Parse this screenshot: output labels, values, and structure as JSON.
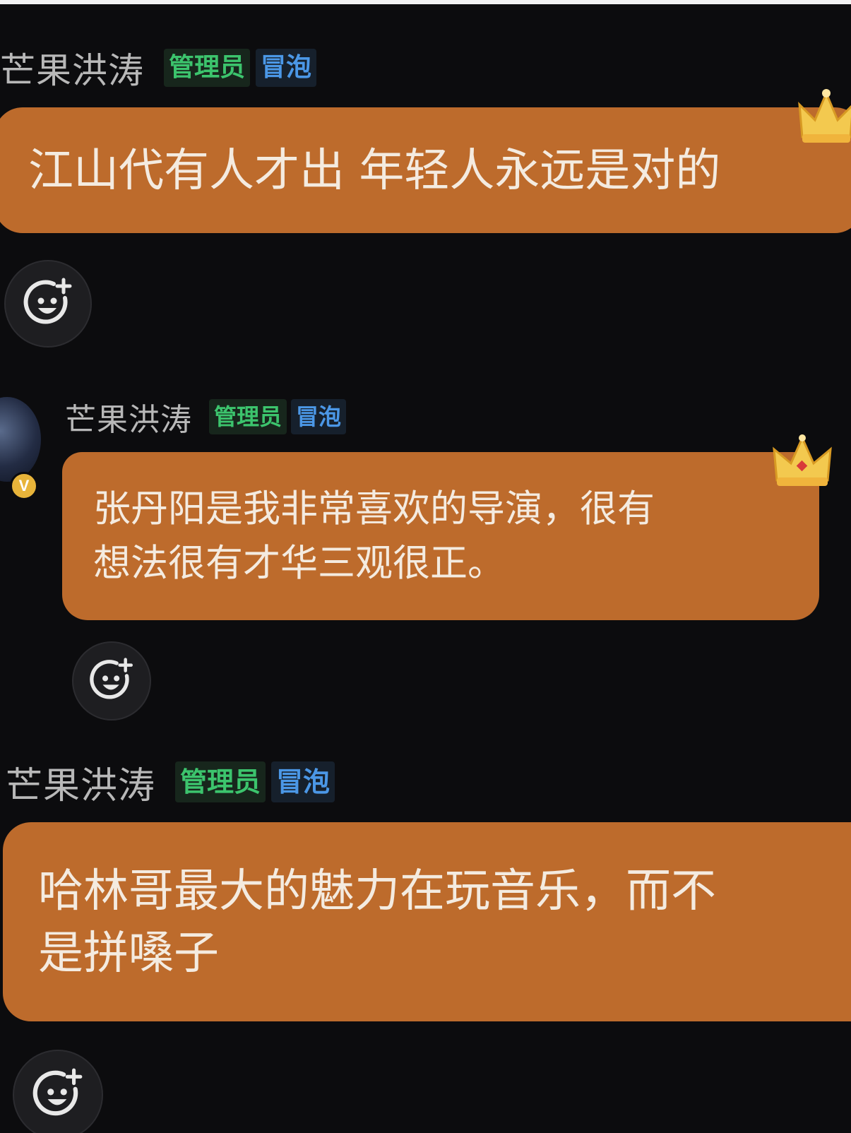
{
  "messages": [
    {
      "username": "芒果洪涛",
      "badges": {
        "admin": "管理员",
        "bubble": "冒泡"
      },
      "text": "江山代有人才出 年轻人永远是对的",
      "react_icon": "emoji-add-icon"
    },
    {
      "username": "芒果洪涛",
      "badges": {
        "admin": "管理员",
        "bubble": "冒泡"
      },
      "text_lines": [
        "张丹阳是我非常喜欢的导演，很有",
        "想法很有才华三观很正。"
      ],
      "verified_label": "V",
      "react_icon": "emoji-add-icon"
    },
    {
      "username": "芒果洪涛",
      "badges": {
        "admin": "管理员",
        "bubble": "冒泡"
      },
      "text_lines": [
        "哈林哥最大的魅力在玩音乐，而不",
        "是拼嗓子"
      ],
      "react_icon": "emoji-add-icon"
    }
  ],
  "colors": {
    "background": "#0c0c0e",
    "bubble": "#bd6b2c",
    "admin_badge": "#3cc46d",
    "bubble_badge": "#4b97e6",
    "username": "#b8b8b8"
  }
}
